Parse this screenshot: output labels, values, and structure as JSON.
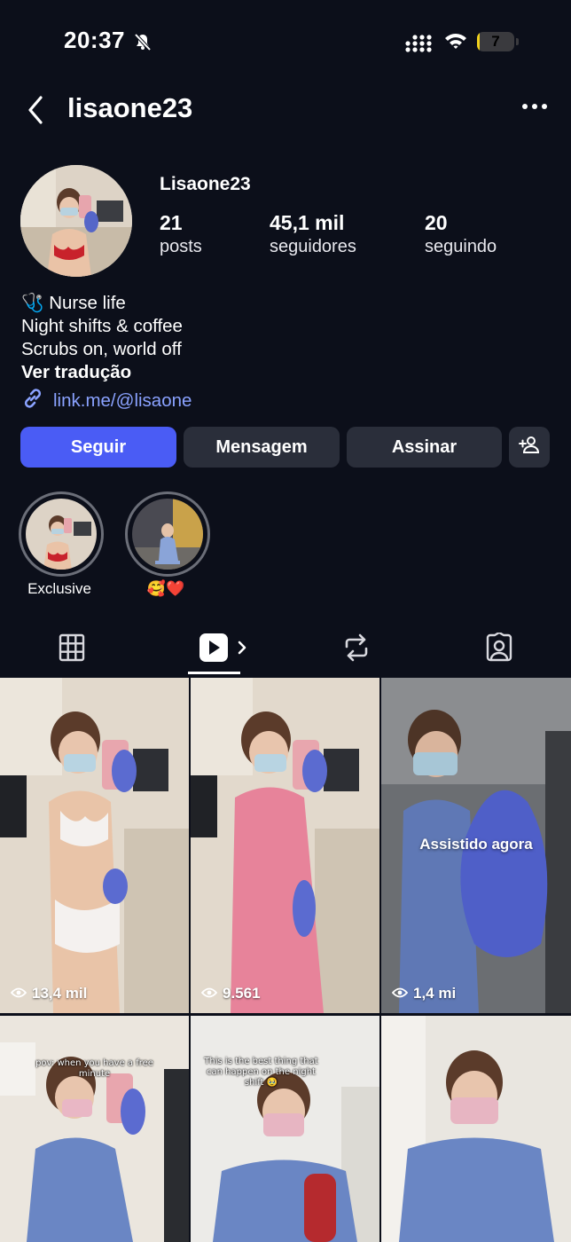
{
  "status_bar": {
    "time": "20:37",
    "battery_level": "7",
    "battery_fraction": 0.07,
    "icons": [
      "bell-slash-icon",
      "signal-icon",
      "wifi-icon",
      "battery-icon"
    ]
  },
  "header": {
    "username": "lisaone23",
    "icons": [
      "back-chevron-icon",
      "more-dots-icon"
    ]
  },
  "profile": {
    "display_name": "Lisaone23",
    "stats": [
      {
        "value": "21",
        "label": "posts"
      },
      {
        "value": "45,1 mil",
        "label": "seguidores"
      },
      {
        "value": "20",
        "label": "seguindo"
      }
    ],
    "bio": {
      "line1_emoji": "🩺",
      "line1_text": " Nurse life",
      "line2": "Night shifts & coffee",
      "line3": "Scrubs on, world off",
      "translate": "Ver tradução"
    },
    "link": "link.me/@lisaone"
  },
  "actions": {
    "follow": "Seguir",
    "message": "Mensagem",
    "subscribe": "Assinar",
    "add_friend_icon": "add-person-icon"
  },
  "highlights": [
    {
      "label": "Exclusive"
    },
    {
      "label": "🥰❤️"
    }
  ],
  "tabs": [
    "grid-icon",
    "reels-icon",
    "reposts-icon",
    "tagged-icon"
  ],
  "posts": [
    {
      "views": "13,4 mil"
    },
    {
      "views": "9.561"
    },
    {
      "views": "1,4 mi",
      "overlay": "Assistido agora"
    },
    {
      "caption": "pov: when you have a free minute"
    },
    {
      "caption": "This is the best thing that can happen on the night shift 🥹"
    },
    {}
  ],
  "colors": {
    "background": "#0c0f1a",
    "primary_button": "#4a5cf5",
    "secondary_button": "#2a2e3a",
    "link": "#8aa2ff",
    "battery": "#f2d21b"
  }
}
